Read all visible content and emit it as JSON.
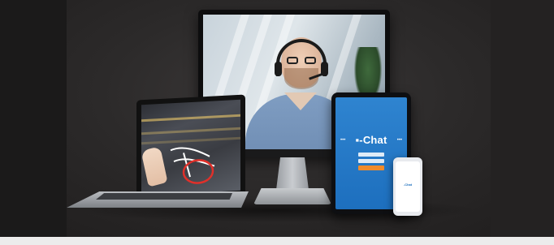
{
  "hero": {
    "alt_devices": [
      "desktop-monitor",
      "laptop",
      "tablet",
      "smartphone"
    ]
  },
  "tablet_app": {
    "logo_text": "-Chat",
    "logo_icon": "chat-bubble-icon",
    "dots_left": "•••",
    "dots_right": "•••",
    "login_button_color": "#f08b2b"
  },
  "phone_app": {
    "logo_text": "-Chat"
  },
  "colors": {
    "background": "#2c2a2a",
    "app_blue": "#1d6fbe",
    "accent_orange": "#f08b2b"
  }
}
